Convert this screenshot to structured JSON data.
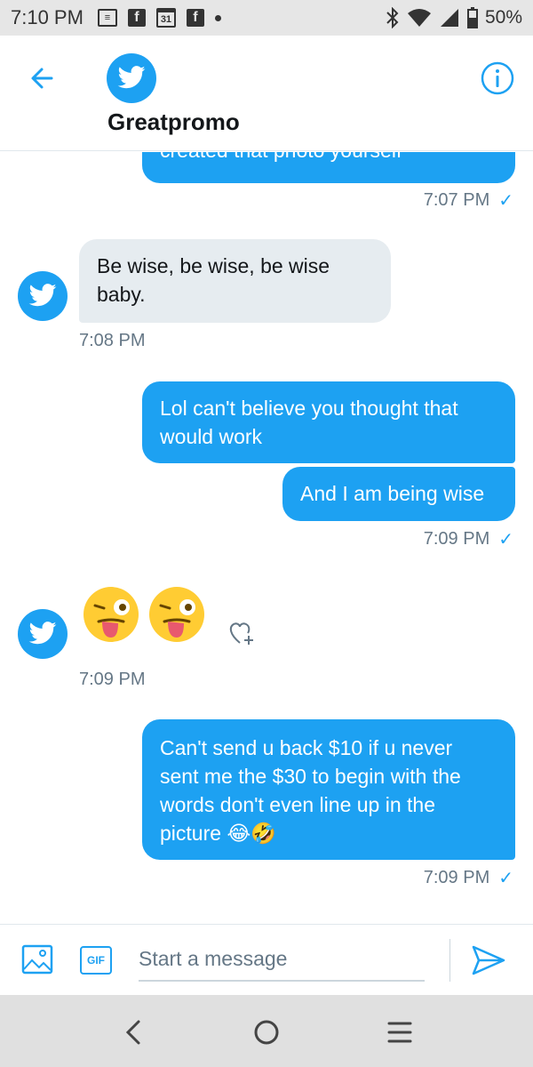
{
  "status_bar": {
    "time": "7:10 PM",
    "battery": "50%",
    "calendar_day": "31",
    "fb_glyph": "f"
  },
  "header": {
    "name": "Greatpromo"
  },
  "messages": [
    {
      "direction": "out",
      "text": "created that photo yourself",
      "timestamp": "7:07 PM"
    },
    {
      "direction": "in",
      "text_lines": [
        "Be wise, be wise, be wise",
        "baby."
      ],
      "timestamp": "7:08 PM"
    },
    {
      "direction": "out",
      "text_lines": [
        "Lol can't believe you thought that",
        "would work"
      ]
    },
    {
      "direction": "out",
      "text": "And I am being wise",
      "timestamp": "7:09 PM"
    },
    {
      "direction": "in",
      "emoji": [
        "winking-face-with-tongue",
        "winking-face-with-tongue"
      ],
      "timestamp": "7:09 PM"
    },
    {
      "direction": "out",
      "text_lines": [
        "Can't send u back $10 if u never",
        "sent me the $30 to begin with the",
        "words don't even line up in the",
        "picture 😂🤣"
      ],
      "timestamp": "7:09 PM"
    }
  ],
  "composer": {
    "placeholder": "Start a message",
    "gif_label": "GIF"
  },
  "colors": {
    "accent": "#1da1f2",
    "incoming_bubble": "#e6ecf0",
    "status_bar": "#e6e6e6"
  }
}
